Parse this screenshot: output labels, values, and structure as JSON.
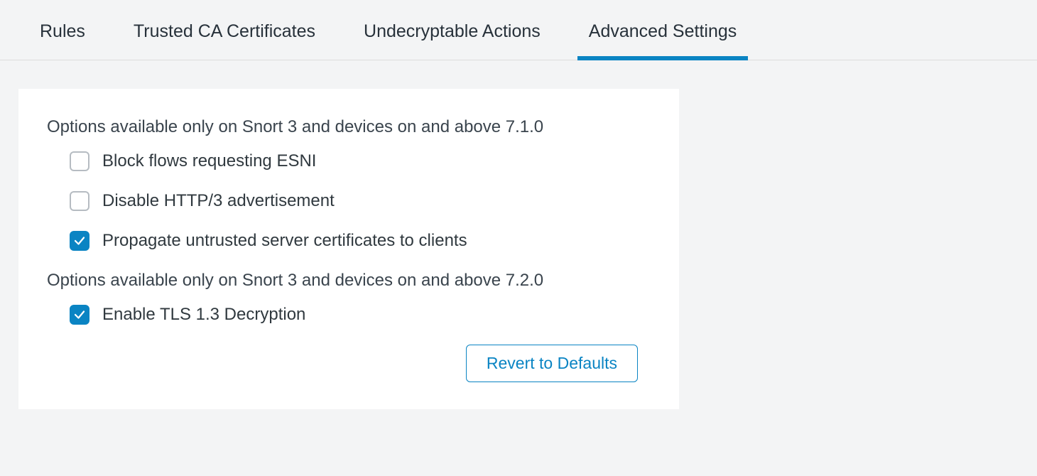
{
  "tabs": [
    {
      "label": "Rules",
      "active": false
    },
    {
      "label": "Trusted CA Certificates",
      "active": false
    },
    {
      "label": "Undecryptable Actions",
      "active": false
    },
    {
      "label": "Advanced Settings",
      "active": true
    }
  ],
  "panel": {
    "group1_heading": "Options available only on Snort 3 and devices on and above 7.1.0",
    "options1": [
      {
        "label": "Block flows requesting ESNI",
        "checked": false
      },
      {
        "label": "Disable HTTP/3 advertisement",
        "checked": false
      },
      {
        "label": "Propagate untrusted server certificates to clients",
        "checked": true
      }
    ],
    "group2_heading": "Options available only on Snort 3 and devices on and above 7.2.0",
    "options2": [
      {
        "label": "Enable TLS 1.3 Decryption",
        "checked": true
      }
    ],
    "revert_button": "Revert to Defaults"
  }
}
